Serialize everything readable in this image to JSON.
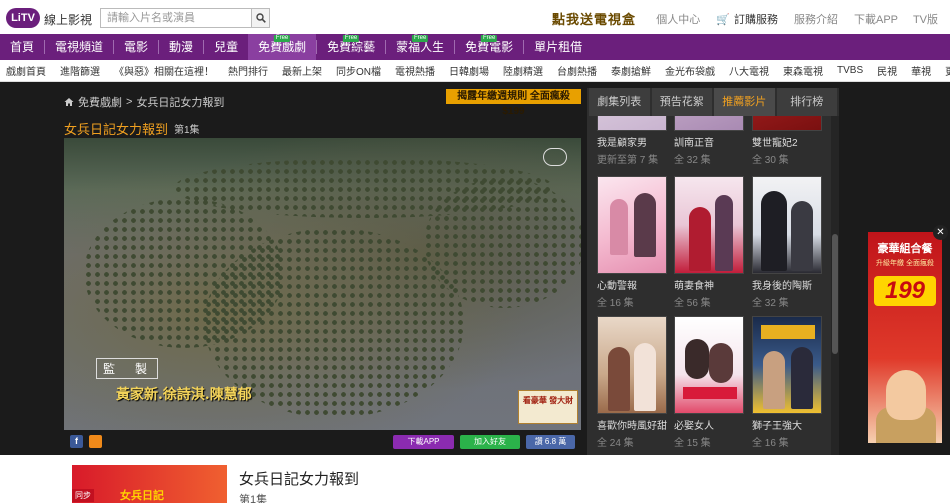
{
  "header": {
    "logo": "LiTV",
    "logo_sub": "線上影視",
    "search_placeholder": "請輸入片名或演員",
    "promo": "點我送電視盒",
    "links": {
      "member": "個人中心",
      "subscribe": "訂購服務",
      "service": "服務介紹",
      "download": "下載APP",
      "tv": "TV版"
    }
  },
  "main_nav": [
    {
      "label": "首頁",
      "free": ""
    },
    {
      "label": "電視頻道",
      "free": ""
    },
    {
      "label": "電影",
      "free": ""
    },
    {
      "label": "動漫",
      "free": ""
    },
    {
      "label": "兒童",
      "free": ""
    },
    {
      "label": "免費戲劇",
      "free": "Free",
      "active": true
    },
    {
      "label": "免費綜藝",
      "free": "Free"
    },
    {
      "label": "蒙福人生",
      "free": "Free"
    },
    {
      "label": "免費電影",
      "free": "Free"
    },
    {
      "label": "單片租借",
      "free": ""
    }
  ],
  "sub_nav": [
    "戲劇首頁",
    "進階篩選",
    "《與惡》相關在這裡！",
    "熱門排行",
    "最新上架",
    "同步ON檔",
    "電視熱播",
    "日韓劇場",
    "陸劇精選",
    "台劇熱播",
    "泰劇搶鮮",
    "金光布袋戲",
    "八大電視",
    "東森電視",
    "TVBS",
    "民視",
    "華視",
    "更多"
  ],
  "breadcrumb": {
    "home": "免費戲劇",
    "sep": ">",
    "current": "女兵日記女力報到"
  },
  "event_banner": "揭露年繳週規則 全面瘋殺$199",
  "video": {
    "title": "女兵日記女力報到",
    "episode": "第1集",
    "credit_label": "監　製",
    "credits": "黃家新.徐詩淇.陳慧郁",
    "corner_logo": "看豪華 發大財"
  },
  "actions": {
    "fb": "f",
    "app": "下載APP",
    "line": "加入好友",
    "like": "讚 6.8 萬"
  },
  "panel": {
    "tabs": [
      "劇集列表",
      "預告花絮",
      "推薦影片",
      "排行榜"
    ],
    "active_tab": 2,
    "items": [
      {
        "name": "我是顧家男",
        "count": "更新至第 7 集"
      },
      {
        "name": "訓南正音",
        "count": "全 32 集"
      },
      {
        "name": "雙世寵妃2",
        "count": "全 30 集"
      },
      {
        "name": "心動警報",
        "count": "全 16 集"
      },
      {
        "name": "萌妻食神",
        "count": "全 56 集"
      },
      {
        "name": "我身後的陶斯",
        "count": "全 32 集"
      },
      {
        "name": "喜歡你時風好甜",
        "count": "全 24 集"
      },
      {
        "name": "必娶女人",
        "count": "全 15 集"
      },
      {
        "name": "獅子王強大",
        "count": "全 16 集"
      }
    ]
  },
  "side_ad": {
    "title": "豪華組合餐",
    "sub": "升級年繳 全面瘋殺",
    "price": "199"
  },
  "bottom": {
    "tag": "同步",
    "thumb_text": "女兵日記",
    "title": "女兵日記女力報到",
    "episode": "第1集"
  },
  "colors": {
    "brand": "#6b1f7c",
    "accent": "#f0a020",
    "free": "#2aa84a"
  }
}
